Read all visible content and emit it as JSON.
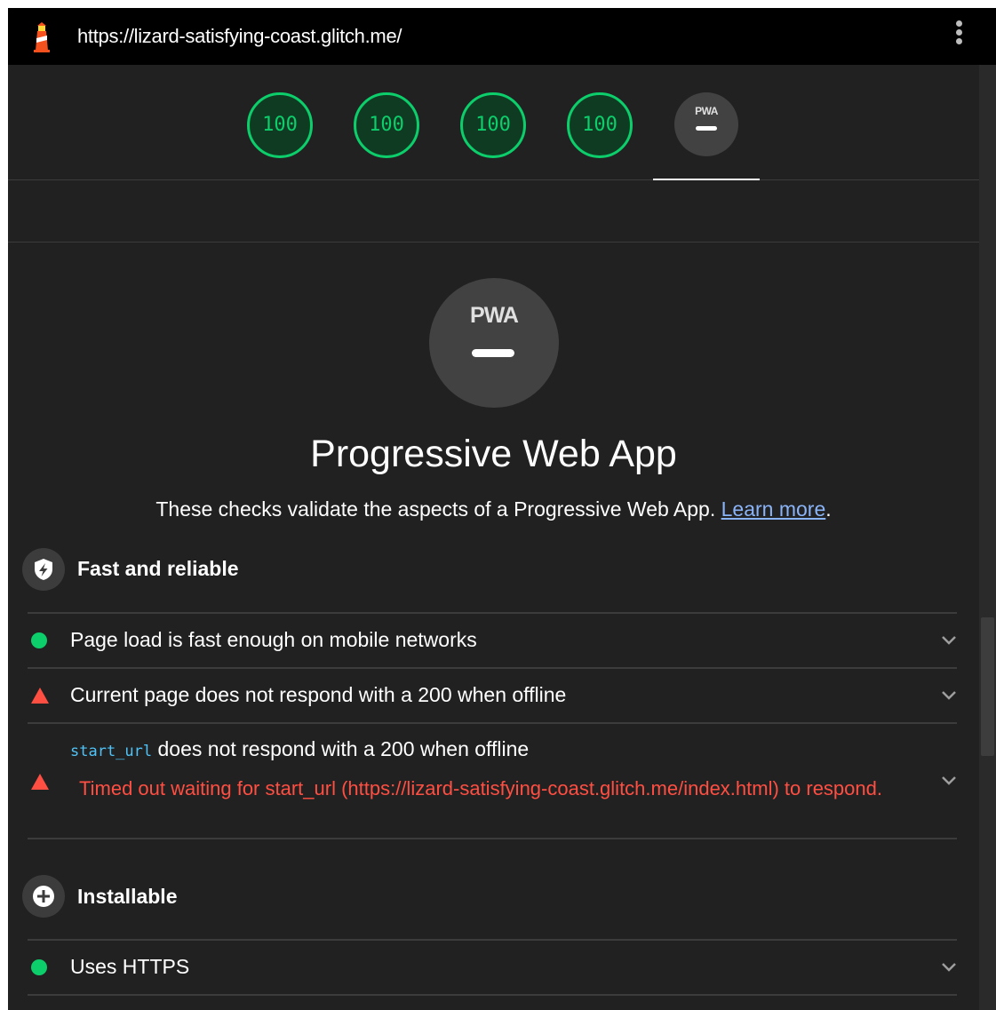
{
  "browser": {
    "url": "https://lizard-satisfying-coast.glitch.me/"
  },
  "gauges": [
    {
      "score": "100"
    },
    {
      "score": "100"
    },
    {
      "score": "100"
    },
    {
      "score": "100"
    }
  ],
  "pwa_badge_label": "PWA",
  "colors": {
    "pass": "#0cce6b",
    "fail": "#ff4e42",
    "link": "#8ab4f8",
    "background": "#212121"
  },
  "category": {
    "title": "Progressive Web App",
    "description": "These checks validate the aspects of a Progressive Web App. ",
    "learn_more": "Learn more",
    "period": "."
  },
  "groups": {
    "fast_reliable": {
      "title": "Fast and reliable",
      "icon": "shield-lightning-icon",
      "audits": [
        {
          "status": "pass",
          "title": "Page load is fast enough on mobile networks"
        },
        {
          "status": "fail",
          "title": "Current page does not respond with a 200 when offline"
        },
        {
          "status": "fail",
          "code": "start_url",
          "title": " does not respond with a 200 when offline",
          "error": "Timed out waiting for start_url (https://lizard-satisfying-coast.glitch.me/index.html) to respond."
        }
      ]
    },
    "installable": {
      "title": "Installable",
      "icon": "plus-circle-icon",
      "audits": [
        {
          "status": "pass",
          "title": "Uses HTTPS"
        }
      ]
    }
  }
}
